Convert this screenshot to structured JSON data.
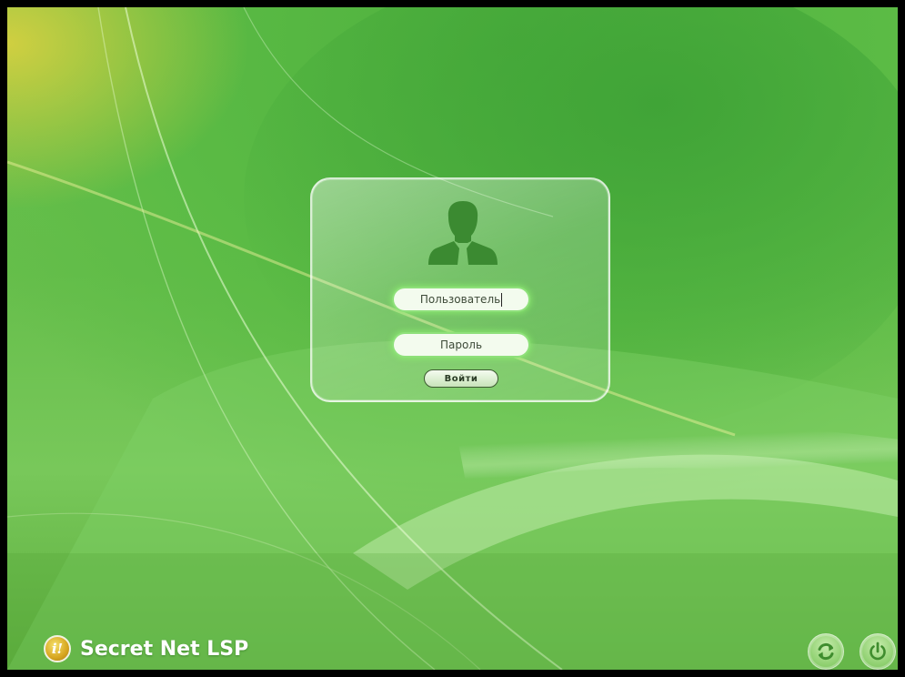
{
  "login": {
    "username_placeholder": "Пользователь",
    "password_placeholder": "Пароль",
    "submit_label": "Войти"
  },
  "brand": {
    "logo_text": "i!",
    "name": "Secret Net LSP"
  },
  "actions": {
    "refresh_icon": "refresh-icon",
    "power_icon": "power-icon"
  },
  "colors": {
    "background": "#5bbb45",
    "field_glow": "#8ee07a",
    "avatar": "#3b8a31"
  }
}
